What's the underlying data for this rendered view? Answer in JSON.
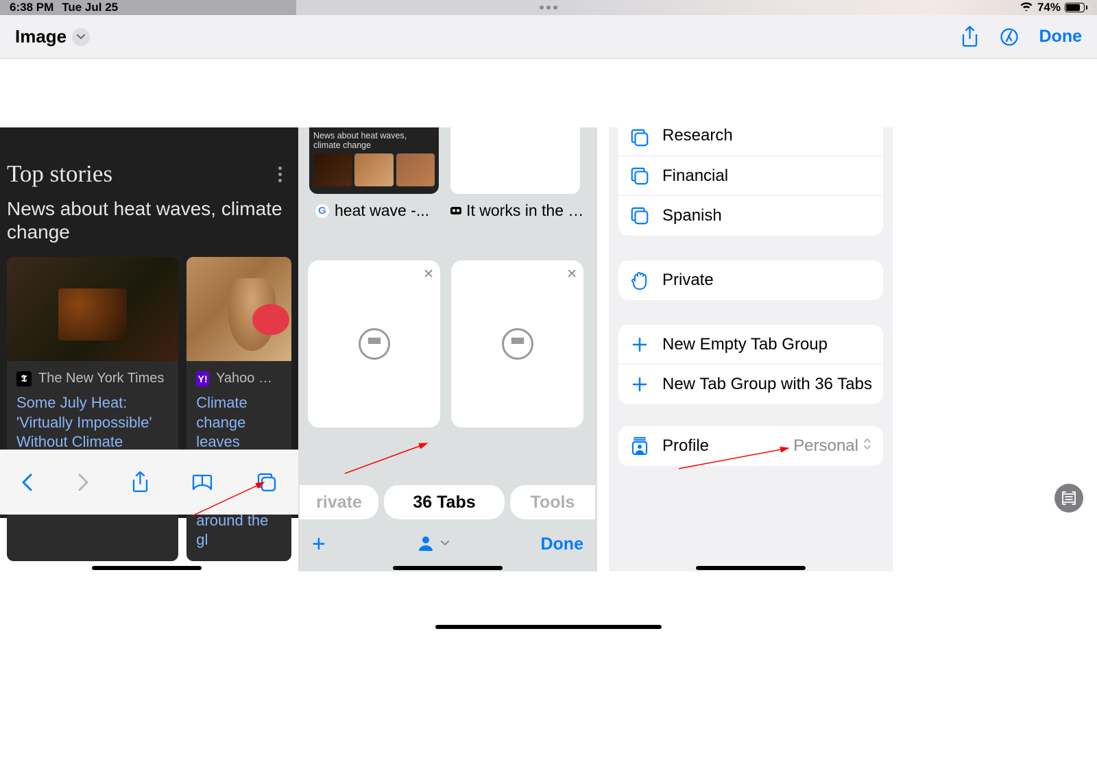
{
  "status": {
    "time": "6:38 PM",
    "date": "Tue Jul 25",
    "battery_pct": "74%"
  },
  "toolbar": {
    "title": "Image",
    "done": "Done"
  },
  "panel1": {
    "top_stories": "Top stories",
    "subtitle": "News about heat waves, climate change",
    "card1": {
      "source": "The New York Times",
      "headline": "Some July Heat: 'Virtually Impossible' Without Climate Change, Analysis..."
    },
    "card2": {
      "source": "Yahoo News",
      "headline": "Climate change leaves fingerprint on July heat waves around the gl"
    }
  },
  "panel2": {
    "mini_caption": "News about heat waves, climate change",
    "tab1": "heat wave -...",
    "tab2": "It works in the bo...",
    "pill_private": "rivate",
    "pill_tabs": "36 Tabs",
    "pill_tools": "Tools",
    "done": "Done"
  },
  "panel3": {
    "group1": {
      "research": "Research",
      "financial": "Financial",
      "spanish": "Spanish"
    },
    "private": "Private",
    "newgroup": {
      "empty": "New Empty Tab Group",
      "withtabs": "New Tab Group with 36 Tabs"
    },
    "profile": {
      "label": "Profile",
      "value": "Personal"
    }
  }
}
